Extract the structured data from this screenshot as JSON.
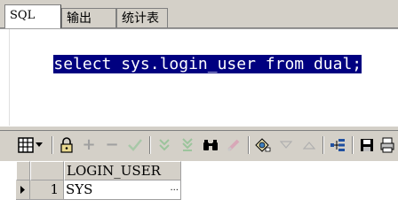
{
  "tabs": [
    {
      "label": "SQL",
      "active": true
    },
    {
      "label": "输出",
      "active": false
    },
    {
      "label": "统计表",
      "active": false
    }
  ],
  "editor": {
    "code": "select sys.login_user from dual;"
  },
  "toolbar": {
    "buttons": [
      {
        "name": "grid-layout-icon",
        "enabled": true
      },
      {
        "name": "dropdown-arrow-icon",
        "enabled": true
      },
      {
        "name": "lock-icon",
        "enabled": true
      },
      {
        "name": "add-record-icon",
        "enabled": false
      },
      {
        "name": "delete-record-icon",
        "enabled": false
      },
      {
        "name": "post-changes-icon",
        "enabled": false
      },
      {
        "name": "fetch-next-icon",
        "enabled": false
      },
      {
        "name": "fetch-all-icon",
        "enabled": false
      },
      {
        "name": "find-icon",
        "enabled": true
      },
      {
        "name": "clear-filter-icon",
        "enabled": false
      },
      {
        "name": "query-by-example-icon",
        "enabled": true
      },
      {
        "name": "previous-record-icon",
        "enabled": false
      },
      {
        "name": "next-record-icon",
        "enabled": false
      },
      {
        "name": "tree-view-icon",
        "enabled": true
      },
      {
        "name": "save-icon",
        "enabled": true
      },
      {
        "name": "print-icon",
        "enabled": true
      }
    ]
  },
  "grid": {
    "columns": [
      "LOGIN_USER"
    ],
    "rows": [
      {
        "num": "1",
        "values": [
          "SYS"
        ],
        "ellipsis": "..."
      }
    ]
  }
}
